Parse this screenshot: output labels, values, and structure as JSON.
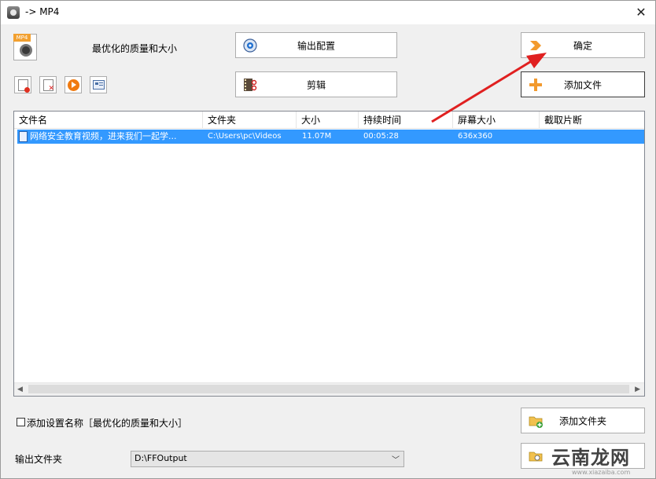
{
  "window": {
    "title": "-> MP4",
    "close": "✕"
  },
  "preset": {
    "label": "最优化的质量和大小"
  },
  "buttons": {
    "output_config": "输出配置",
    "edit": "剪辑",
    "ok": "确定",
    "add_file": "添加文件",
    "add_folder": "添加文件夹"
  },
  "toolbar_icons": [
    "remove-icon",
    "clear-icon",
    "play-icon",
    "info-icon"
  ],
  "file_list": {
    "columns": [
      "文件名",
      "文件夹",
      "大小",
      "持续时间",
      "屏幕大小",
      "截取片断"
    ],
    "rows": [
      {
        "name": "网络安全教育视频，进来我们一起学...",
        "folder": "C:\\Users\\pc\\Videos",
        "size": "11.07M",
        "duration": "00:05:28",
        "resolution": "636x360",
        "clip": ""
      }
    ]
  },
  "options": {
    "add_setting_name_label": "添加设置名称［最优化的质量和大小］",
    "add_setting_name_checked": false,
    "output_folder_label": "输出文件夹",
    "output_folder_value": "D:\\FFOutput"
  },
  "watermark": {
    "main": "云南龙网",
    "sub": "www.xiazaiba.com"
  },
  "colors": {
    "selection": "#3399ff",
    "arrow": "#e02020",
    "accent_orange": "#f29a2e"
  }
}
